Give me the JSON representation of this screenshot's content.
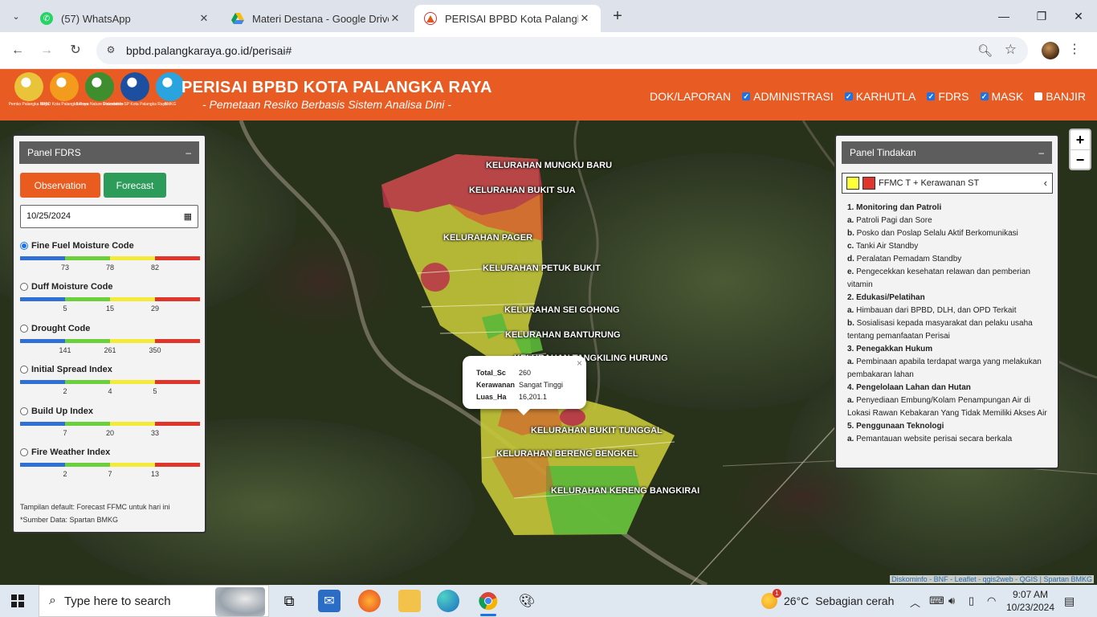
{
  "browser": {
    "tabs": [
      {
        "label": "(57) WhatsApp",
        "icon": "whatsapp-icon"
      },
      {
        "label": "Materi Destana - Google Drive",
        "icon": "google-drive-icon"
      },
      {
        "label": "PERISAI BPBD Kota Palangka Ra",
        "icon": "bpbd-icon",
        "active": true
      }
    ],
    "url": "bpbd.palangkaraya.go.id/perisai#"
  },
  "header": {
    "logos": [
      {
        "caption": "Pemko Palangka Raya",
        "color": "#e9c33a"
      },
      {
        "caption": "BPBD Kota Palangka Raya",
        "color": "#f29b1c"
      },
      {
        "caption": "Borneo Nature Foundation",
        "color": "#3e8d2e"
      },
      {
        "caption": "Diskominfo-SP Kota Palangka Raya",
        "color": "#1d4fa0"
      },
      {
        "caption": "BMKG",
        "color": "#2aa4df"
      }
    ],
    "title": "PERISAI BPBD KOTA PALANGKA RAYA",
    "subtitle": "- Pemetaan Resiko Berbasis Sistem Analisa Dini -",
    "menu": [
      {
        "label": "DOK/LAPORAN",
        "checkbox": null
      },
      {
        "label": "ADMINISTRASI",
        "checkbox": true
      },
      {
        "label": "KARHUTLA",
        "checkbox": true
      },
      {
        "label": "FDRS",
        "checkbox": true
      },
      {
        "label": "MASK",
        "checkbox": true
      },
      {
        "label": "BANJIR",
        "checkbox": false
      }
    ]
  },
  "map": {
    "zoom_in": "+",
    "zoom_out": "−",
    "kelurahan": [
      "KELURAHAN MUNGKU BARU",
      "KELURAHAN BUKIT SUA",
      "KELURAHAN PAGER",
      "KELURAHAN PETUK BUKIT",
      "KELURAHAN SEI GOHONG",
      "KELURAHAN BANTURUNG",
      "KELURAHAN TANGKILING HURUNG",
      "KELURAHAN BUKIT TUNGGAL",
      "KELURAHAN BERENG BENGKEL",
      "KELURAHAN KERENG BANGKIRAI"
    ],
    "popup": {
      "close": "×",
      "rows": [
        {
          "key": "Total_Sc",
          "value": "260"
        },
        {
          "key": "Kerawanan",
          "value": "Sangat Tinggi"
        },
        {
          "key": "Luas_Ha",
          "value": "16,201.1"
        }
      ]
    },
    "attribution": "Diskominfo - BNF - Leaflet - qgis2web - QGIS | Spartan BMKG",
    "colors": {
      "very_high": "#b8324a",
      "high": "#d9572d",
      "moderate": "#c7c93a",
      "low": "#5bb83a"
    }
  },
  "panel_fdrs": {
    "title": "Panel FDRS",
    "collapse": "–",
    "observation_label": "Observation",
    "forecast_label": "Forecast",
    "date_value": "10/25/2024",
    "scale_colors": [
      "#2f6fd6",
      "#6bd03c",
      "#f3ea3a",
      "#e0352b"
    ],
    "indices": [
      {
        "label": "Fine Fuel Moisture Code",
        "selected": true,
        "ticks": [
          "73",
          "78",
          "82"
        ]
      },
      {
        "label": "Duff Moisture Code",
        "selected": false,
        "ticks": [
          "5",
          "15",
          "29"
        ]
      },
      {
        "label": "Drought Code",
        "selected": false,
        "ticks": [
          "141",
          "261",
          "350"
        ]
      },
      {
        "label": "Initial Spread Index",
        "selected": false,
        "ticks": [
          "2",
          "4",
          "5"
        ]
      },
      {
        "label": "Build Up Index",
        "selected": false,
        "ticks": [
          "7",
          "20",
          "33"
        ]
      },
      {
        "label": "Fire Weather Index",
        "selected": false,
        "ticks": [
          "2",
          "7",
          "13"
        ]
      }
    ],
    "note_default": "Tampilan default: Forecast FFMC untuk hari ini",
    "note_source": "*Sumber Data: Spartan BMKG"
  },
  "panel_tindakan": {
    "title": "Panel Tindakan",
    "collapse": "–",
    "legend_label": "FFMC T + Kerawanan ST",
    "legend_colors": [
      "#ffff3a",
      "#e0352b"
    ],
    "sections": [
      {
        "heading": "1. Monitoring dan Patroli",
        "items": [
          {
            "letter": "a.",
            "text": "Patroli Pagi dan Sore"
          },
          {
            "letter": "b.",
            "text": "Posko dan Poslap Selalu Aktif Berkomunikasi"
          },
          {
            "letter": "c.",
            "text": "Tanki Air Standby"
          },
          {
            "letter": "d.",
            "text": "Peralatan Pemadam Standby"
          },
          {
            "letter": "e.",
            "text": "Pengecekkan kesehatan relawan dan pemberian vitamin"
          }
        ]
      },
      {
        "heading": "2. Edukasi/Pelatihan",
        "items": [
          {
            "letter": "a.",
            "text": "Himbauan dari BPBD, DLH, dan OPD Terkait"
          },
          {
            "letter": "b.",
            "text": "Sosialisasi kepada masyarakat dan pelaku usaha tentang pemanfaatan Perisai"
          }
        ]
      },
      {
        "heading": "3. Penegakkan Hukum",
        "items": [
          {
            "letter": "a.",
            "text": "Pembinaan apabila terdapat warga yang melakukan pembakaran lahan"
          }
        ]
      },
      {
        "heading": "4. Pengelolaan Lahan dan Hutan",
        "items": [
          {
            "letter": "a.",
            "text": "Penyediaan Embung/Kolam Penampungan Air di Lokasi Rawan Kebakaran Yang Tidak Memiliki Akses Air"
          }
        ]
      },
      {
        "heading": "5. Penggunaan Teknologi",
        "items": [
          {
            "letter": "a.",
            "text": "Pemantauan website perisai secara berkala"
          }
        ]
      }
    ]
  },
  "taskbar": {
    "search_placeholder": "Type here to search",
    "weather_temp": "26°C",
    "weather_text": "Sebagian cerah",
    "weather_badge": "1",
    "time": "9:07 AM",
    "date": "10/23/2024"
  }
}
